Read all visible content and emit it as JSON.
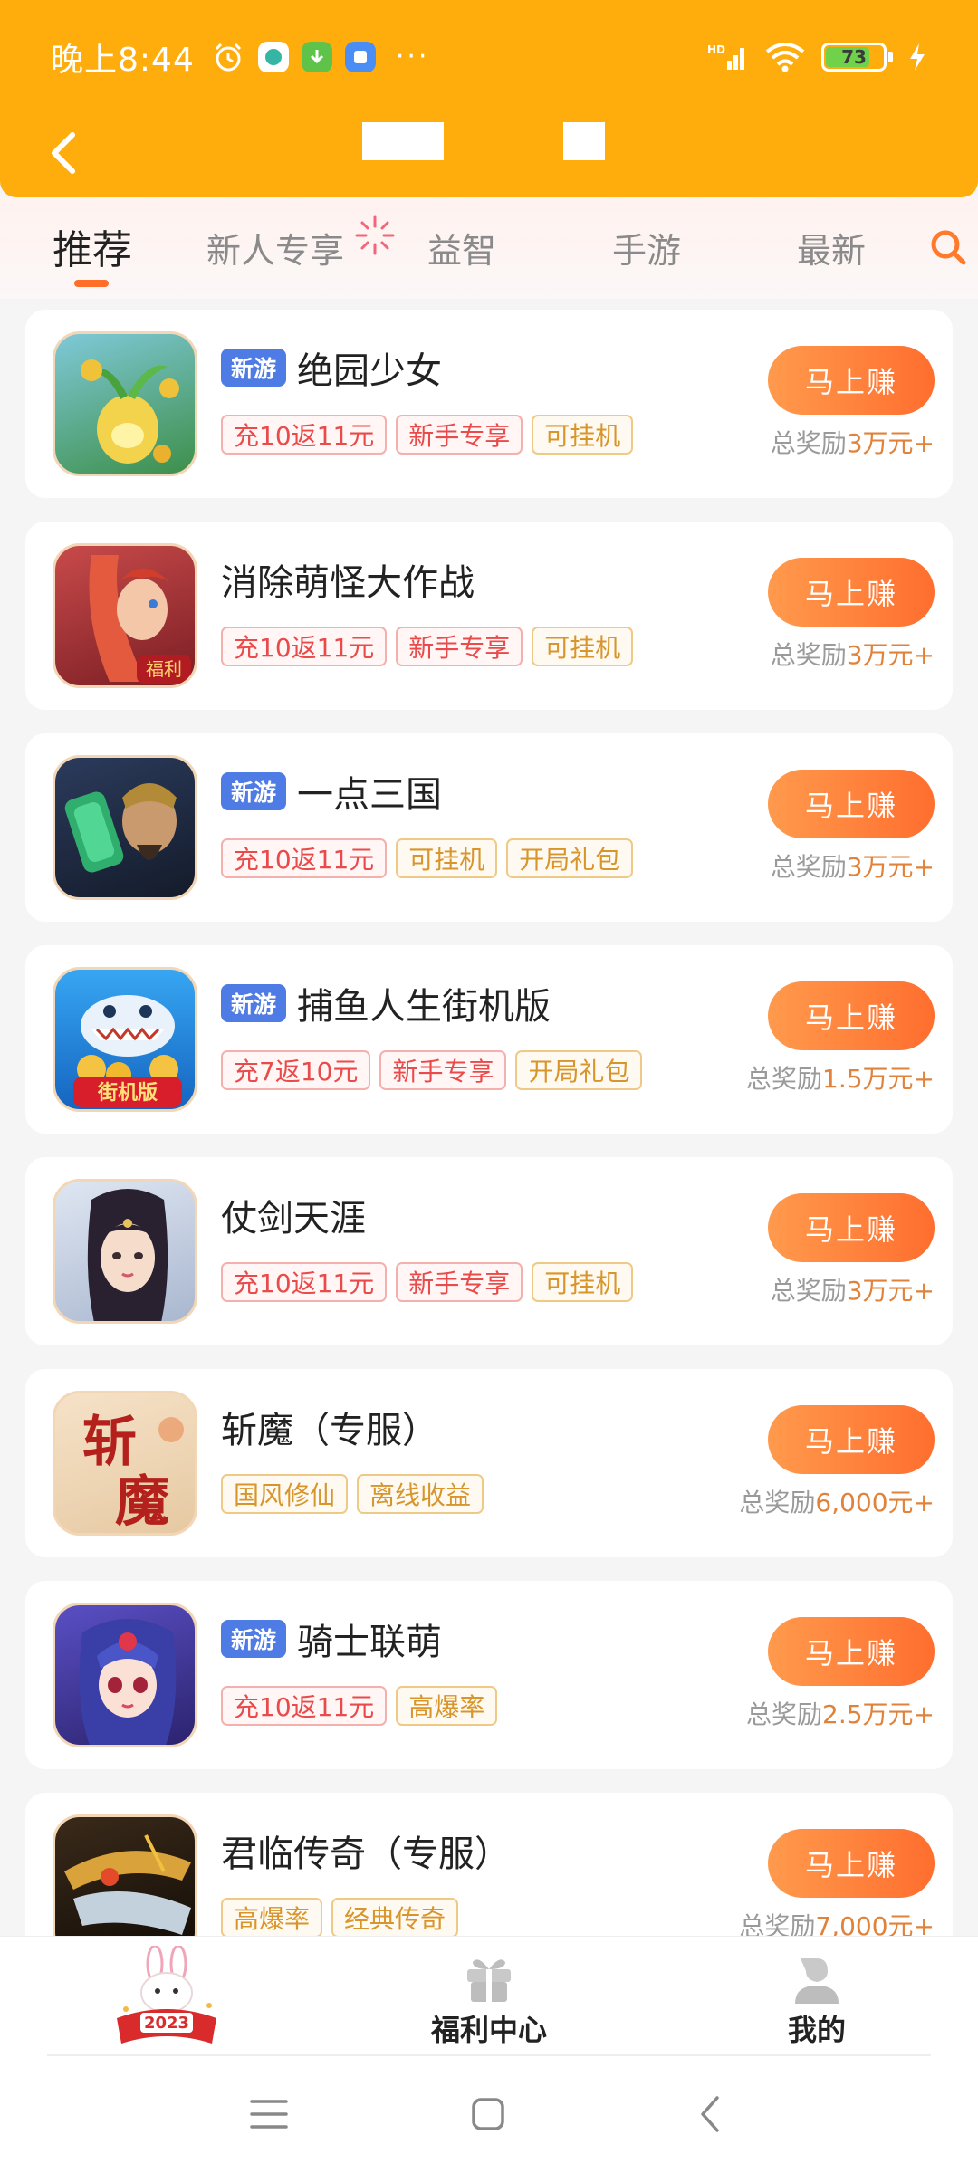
{
  "status_bar": {
    "time": "晚上8:44",
    "more": "···",
    "network": "HD",
    "battery_level": "73"
  },
  "tabs": [
    "推荐",
    "新人专享",
    "益智",
    "手游",
    "最新"
  ],
  "games": [
    {
      "name": "绝园少女",
      "is_new": true,
      "tags": [
        {
          "text": "充10返11元",
          "style": "red"
        },
        {
          "text": "新手专享",
          "style": "red"
        },
        {
          "text": "可挂机",
          "style": "gold"
        }
      ],
      "button": "马上赚",
      "reward_prefix": "总奖励",
      "reward_amount": "3万元+"
    },
    {
      "name": "消除萌怪大作战",
      "is_new": false,
      "tags": [
        {
          "text": "充10返11元",
          "style": "red"
        },
        {
          "text": "新手专享",
          "style": "red"
        },
        {
          "text": "可挂机",
          "style": "gold"
        }
      ],
      "button": "马上赚",
      "reward_prefix": "总奖励",
      "reward_amount": "3万元+"
    },
    {
      "name": "一点三国",
      "is_new": true,
      "tags": [
        {
          "text": "充10返11元",
          "style": "red"
        },
        {
          "text": "可挂机",
          "style": "gold"
        },
        {
          "text": "开局礼包",
          "style": "gold"
        }
      ],
      "button": "马上赚",
      "reward_prefix": "总奖励",
      "reward_amount": "3万元+"
    },
    {
      "name": "捕鱼人生街机版",
      "is_new": true,
      "tags": [
        {
          "text": "充7返10元",
          "style": "red"
        },
        {
          "text": "新手专享",
          "style": "red"
        },
        {
          "text": "开局礼包",
          "style": "gold"
        }
      ],
      "button": "马上赚",
      "reward_prefix": "总奖励",
      "reward_amount": "1.5万元+"
    },
    {
      "name": "仗剑天涯",
      "is_new": false,
      "tags": [
        {
          "text": "充10返11元",
          "style": "red"
        },
        {
          "text": "新手专享",
          "style": "red"
        },
        {
          "text": "可挂机",
          "style": "gold"
        }
      ],
      "button": "马上赚",
      "reward_prefix": "总奖励",
      "reward_amount": "3万元+"
    },
    {
      "name": "斩魔（专服）",
      "is_new": false,
      "tags": [
        {
          "text": "国风修仙",
          "style": "gold"
        },
        {
          "text": "离线收益",
          "style": "gold"
        }
      ],
      "button": "马上赚",
      "reward_prefix": "总奖励",
      "reward_amount": "6,000元+"
    },
    {
      "name": "骑士联萌",
      "is_new": true,
      "tags": [
        {
          "text": "充10返11元",
          "style": "red"
        },
        {
          "text": "高爆率",
          "style": "gold"
        }
      ],
      "button": "马上赚",
      "reward_prefix": "总奖励",
      "reward_amount": "2.5万元+"
    },
    {
      "name": "君临传奇（专服）",
      "is_new": false,
      "tags": [
        {
          "text": "高爆率",
          "style": "gold"
        },
        {
          "text": "经典传奇",
          "style": "gold"
        }
      ],
      "button": "马上赚",
      "reward_prefix": "总奖励",
      "reward_amount": "7,000元+"
    }
  ],
  "new_badge_label": "新游",
  "icon_texts": {
    "game2": "福利",
    "game4": "街机版",
    "game6_top": "斩",
    "game6_bottom": "魔"
  },
  "bottom_nav": {
    "home_badge": "2023",
    "welfare": "福利中心",
    "mine": "我的"
  },
  "colors": {
    "header": "#ffad0d",
    "accent": "#ff6e2a",
    "new_badge": "#4f7be5",
    "tag_red": "#e94a4a",
    "tag_gold": "#d8952b"
  },
  "icons": [
    "back-arrow-icon",
    "search-icon",
    "gift-icon",
    "user-icon",
    "menu-icon",
    "home-square-icon",
    "back-triangle-icon"
  ]
}
